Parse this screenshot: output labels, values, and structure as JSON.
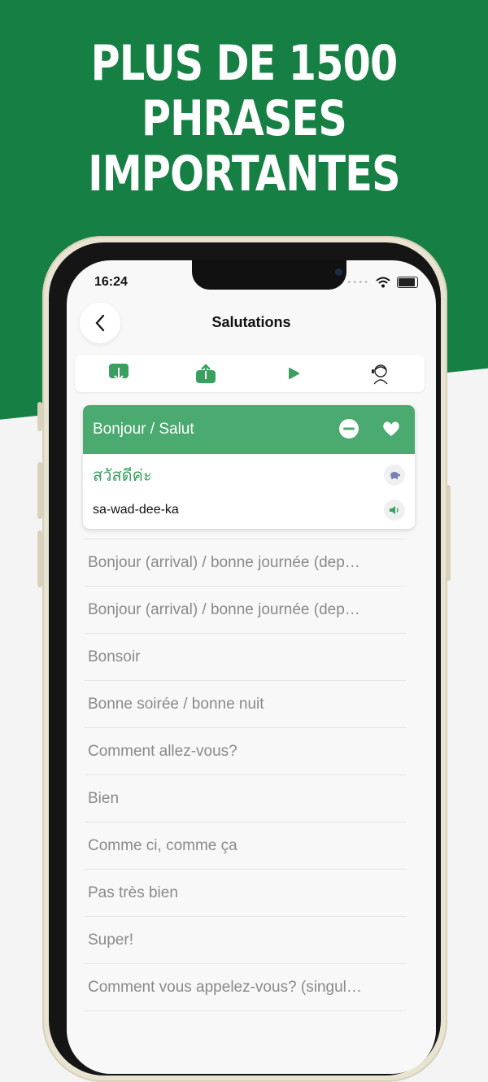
{
  "headline": {
    "line1": "PLUS DE 1500",
    "line2": "PHRASES",
    "line3": "IMPORTANTES"
  },
  "status": {
    "time": "16:24"
  },
  "header": {
    "title": "Salutations"
  },
  "toolbar": {
    "icons": [
      "download-icon",
      "share-icon",
      "play-icon",
      "tutor-icon"
    ]
  },
  "selected": {
    "phrase": "Bonjour / Salut",
    "thai": "สวัสดีค่ะ",
    "romanization": "sa-wad-dee-ka"
  },
  "list": [
    "Bonjour (arrival) / bonne journée (dep…",
    "Bonjour (arrival) / bonne journée (dep…",
    "Bonsoir",
    "Bonne soirée / bonne nuit",
    "Comment allez-vous?",
    "Bien",
    "Comme ci, comme ça",
    "Pas très bien",
    "Super!",
    "Comment vous appelez-vous? (singul…"
  ],
  "colors": {
    "brand_green": "#168044",
    "accent_green": "#4aaa70"
  }
}
